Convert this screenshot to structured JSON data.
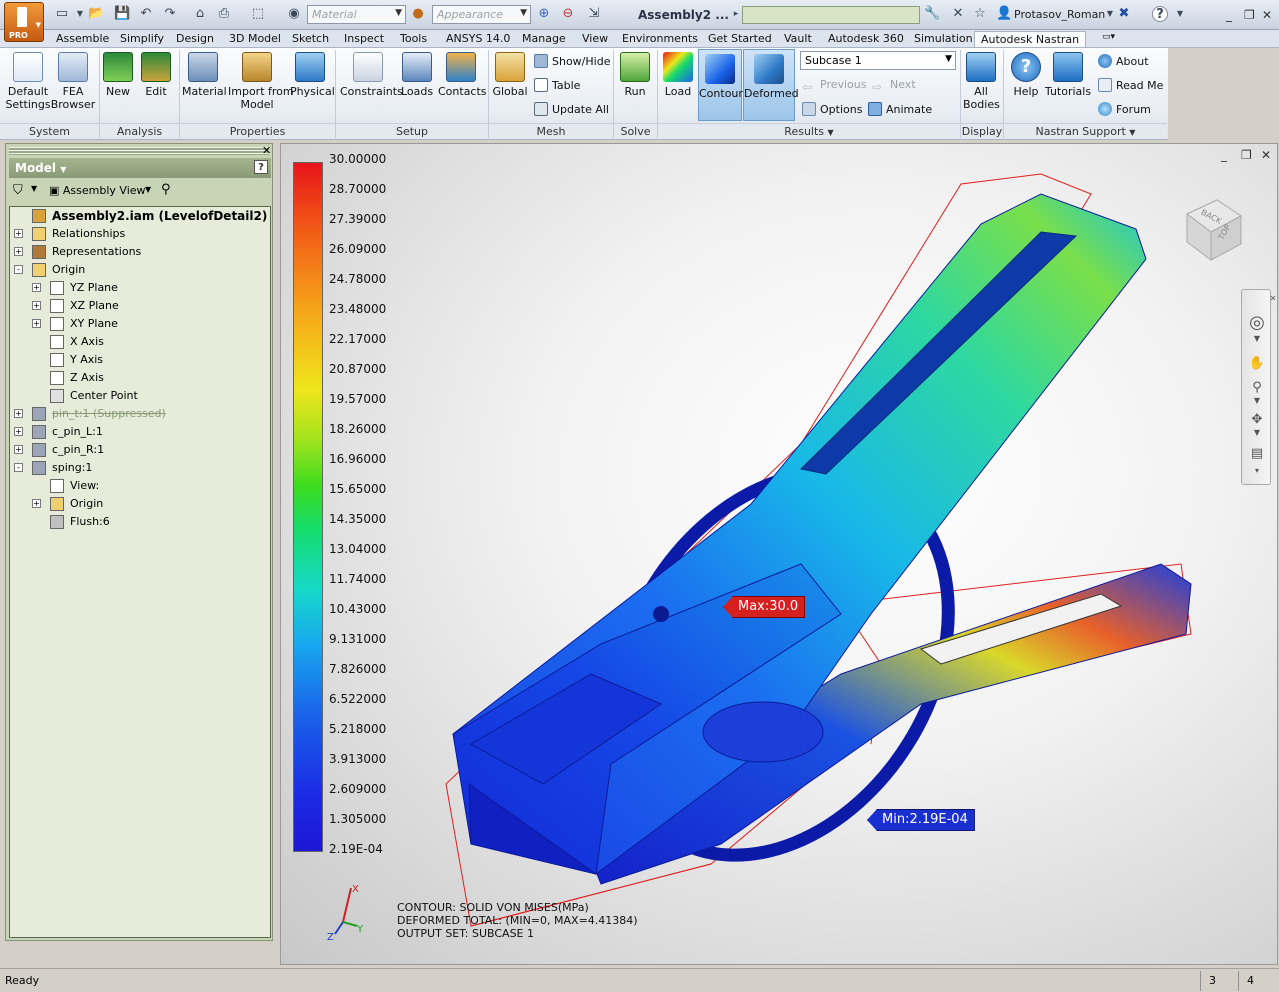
{
  "titlebar": {
    "material_placeholder": "Material",
    "appearance_placeholder": "Appearance",
    "document_title": "Assembly2 ...",
    "user_name": "Protasov_Roman",
    "app_badge": "PRO"
  },
  "menu_tabs": [
    "Assemble",
    "Simplify",
    "Design",
    "3D Model",
    "Sketch",
    "Inspect",
    "Tools",
    "ANSYS 14.0",
    "Manage",
    "View",
    "Environments",
    "Get Started",
    "Vault",
    "Autodesk 360",
    "Simulation",
    "Autodesk Nastran"
  ],
  "ribbon": {
    "system": {
      "label": "System",
      "default_settings": "Default\nSettings"
    },
    "analysis": {
      "label": "Analysis",
      "fea_browser": "FEA\nBrowser",
      "new": "New",
      "edit": "Edit"
    },
    "properties": {
      "label": "Properties",
      "material": "Material",
      "import_from_model": "Import from\nModel",
      "physical": "Physical"
    },
    "setup": {
      "label": "Setup",
      "constraints": "Constraints",
      "loads": "Loads",
      "contacts": "Contacts"
    },
    "mesh": {
      "label": "Mesh",
      "global": "Global",
      "show_hide": "Show/Hide",
      "table": "Table",
      "update_all": "Update  All"
    },
    "solve": {
      "label": "Solve",
      "run": "Run"
    },
    "results": {
      "label": "Results",
      "load": "Load",
      "contour": "Contour",
      "deformed": "Deformed",
      "subcase": "Subcase 1",
      "previous": "Previous",
      "next": "Next",
      "options": "Options",
      "animate": "Animate"
    },
    "display": {
      "label": "Display",
      "all_bodies": "All\nBodies"
    },
    "nastran_support": {
      "label": "Nastran Support",
      "help": "Help",
      "tutorials": "Tutorials",
      "about": "About",
      "read_me": "Read Me",
      "forum": "Forum"
    }
  },
  "browser": {
    "title": "Model",
    "view_mode": "Assembly View",
    "tree": [
      {
        "label": "Assembly2.iam (LevelofDetail2)",
        "level": 0,
        "expander": "",
        "icon": "assembly-icon",
        "style": "bold"
      },
      {
        "label": "Relationships",
        "level": 0,
        "expander": "+",
        "icon": "folder-icon",
        "style": ""
      },
      {
        "label": "Representations",
        "level": 0,
        "expander": "+",
        "icon": "representations-icon",
        "style": ""
      },
      {
        "label": "Origin",
        "level": 0,
        "expander": "-",
        "icon": "folder-icon",
        "style": ""
      },
      {
        "label": "YZ Plane",
        "level": 1,
        "expander": "+",
        "icon": "plane-icon",
        "style": ""
      },
      {
        "label": "XZ Plane",
        "level": 1,
        "expander": "+",
        "icon": "plane-icon",
        "style": ""
      },
      {
        "label": "XY Plane",
        "level": 1,
        "expander": "+",
        "icon": "plane-icon",
        "style": ""
      },
      {
        "label": "X Axis",
        "level": 1,
        "expander": "",
        "icon": "axis-icon",
        "style": ""
      },
      {
        "label": "Y Axis",
        "level": 1,
        "expander": "",
        "icon": "axis-icon",
        "style": ""
      },
      {
        "label": "Z Axis",
        "level": 1,
        "expander": "",
        "icon": "axis-icon",
        "style": ""
      },
      {
        "label": "Center Point",
        "level": 1,
        "expander": "",
        "icon": "point-icon",
        "style": ""
      },
      {
        "label": "pin_t:1 (Suppressed)",
        "level": 0,
        "expander": "+",
        "icon": "part-icon",
        "style": "supp"
      },
      {
        "label": "c_pin_L:1",
        "level": 0,
        "expander": "+",
        "icon": "part-icon",
        "style": ""
      },
      {
        "label": "c_pin_R:1",
        "level": 0,
        "expander": "+",
        "icon": "part-icon",
        "style": ""
      },
      {
        "label": "sping:1",
        "level": 0,
        "expander": "-",
        "icon": "part-icon",
        "style": ""
      },
      {
        "label": "View:",
        "level": 1,
        "expander": "",
        "icon": "view-icon",
        "style": ""
      },
      {
        "label": "Origin",
        "level": 1,
        "expander": "+",
        "icon": "folder-icon",
        "style": ""
      },
      {
        "label": "Flush:6",
        "level": 1,
        "expander": "",
        "icon": "constraint-icon",
        "style": ""
      }
    ]
  },
  "legend": [
    "30.00000",
    "28.70000",
    "27.39000",
    "26.09000",
    "24.78000",
    "23.48000",
    "22.17000",
    "20.87000",
    "19.57000",
    "18.26000",
    "16.96000",
    "15.65000",
    "14.35000",
    "13.04000",
    "11.74000",
    "10.43000",
    "9.131000",
    "7.826000",
    "6.522000",
    "5.218000",
    "3.913000",
    "2.609000",
    "1.305000",
    "2.19E-04"
  ],
  "viewport": {
    "callout_max": "Max:30.0",
    "callout_min": "Min:2.19E-04",
    "info_lines": [
      "CONTOUR: SOLID VON MISES(MPa)",
      "DEFORMED TOTAL: (MIN=0, MAX=4.41384)",
      "OUTPUT SET: SUBCASE 1"
    ],
    "viewcube_labels": [
      "BACK",
      "TOP"
    ],
    "triad": {
      "x": "X",
      "y": "Y",
      "z": "Z"
    }
  },
  "status": {
    "text": "Ready",
    "cell1": "3",
    "cell2": "4"
  },
  "colors": {
    "accent": "#6a9ccd",
    "browser_bg": "#c7d5b6",
    "max_callout": "#d52020",
    "min_callout": "#1a2fd0"
  }
}
